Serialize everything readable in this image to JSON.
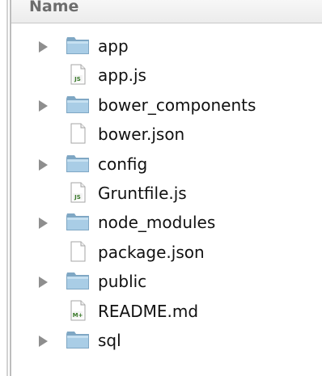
{
  "header": {
    "name_label": "Name"
  },
  "colors": {
    "folder_body": "#a9cde6",
    "folder_border": "#7fa7c4",
    "disclosure_arrow": "#8e8e8e",
    "js_badge": "#3a7a2a"
  },
  "files": [
    {
      "name": "app",
      "kind": "folder",
      "icon": "folder-icon",
      "expandable": true
    },
    {
      "name": "app.js",
      "kind": "js",
      "icon": "js-file-icon",
      "badge": "JS"
    },
    {
      "name": "bower_components",
      "kind": "folder",
      "icon": "folder-icon",
      "expandable": true
    },
    {
      "name": "bower.json",
      "kind": "doc",
      "icon": "document-icon"
    },
    {
      "name": "config",
      "kind": "folder",
      "icon": "folder-icon",
      "expandable": true
    },
    {
      "name": "Gruntfile.js",
      "kind": "js",
      "icon": "js-file-icon",
      "badge": "JS"
    },
    {
      "name": "node_modules",
      "kind": "folder",
      "icon": "folder-icon",
      "expandable": true
    },
    {
      "name": "package.json",
      "kind": "doc",
      "icon": "document-icon"
    },
    {
      "name": "public",
      "kind": "folder",
      "icon": "folder-icon",
      "expandable": true
    },
    {
      "name": "README.md",
      "kind": "md",
      "icon": "markdown-file-icon",
      "badge": "M+"
    },
    {
      "name": "sql",
      "kind": "folder",
      "icon": "folder-icon",
      "expandable": true
    }
  ]
}
